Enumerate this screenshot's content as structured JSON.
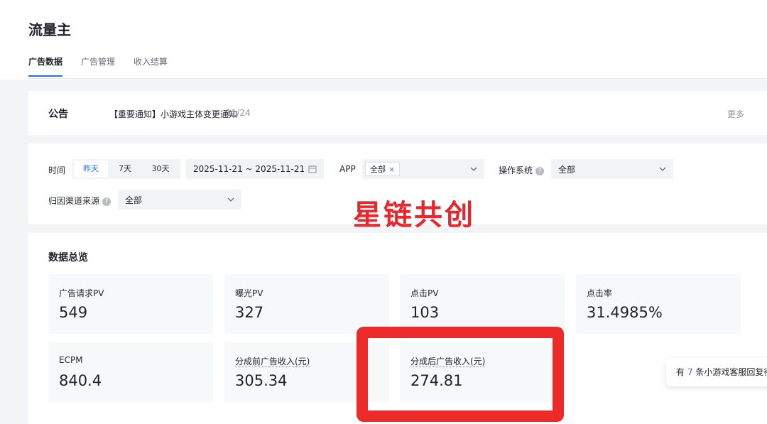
{
  "app": {
    "title": "流量主"
  },
  "tabs": [
    {
      "label": "广告数据",
      "active": true
    },
    {
      "label": "广告管理",
      "active": false
    },
    {
      "label": "收入结算",
      "active": false
    }
  ],
  "notice": {
    "label": "公告",
    "text": "【重要通知】小游戏主体变更通知",
    "date": "11/24",
    "more": "更多"
  },
  "filters": {
    "time_label": "时间",
    "time_options": [
      "昨天",
      "7天",
      "30天"
    ],
    "time_selected": "昨天",
    "date_range": "2025-11-21 ~ 2025-11-21",
    "app_label": "APP",
    "app_tag": "全部",
    "os_label": "操作系统",
    "os_value": "全部",
    "channel_label": "归因渠道来源",
    "channel_value": "全部"
  },
  "watermark": "星链共创",
  "overview": {
    "title": "数据总览",
    "metrics": [
      {
        "label": "广告请求PV",
        "value": "549"
      },
      {
        "label": "曝光PV",
        "value": "327"
      },
      {
        "label": "点击PV",
        "value": "103"
      },
      {
        "label": "点击率",
        "value": "31.4985%"
      },
      {
        "label": "ECPM",
        "value": "840.4"
      },
      {
        "label": "分成前广告收入(元)",
        "value": "305.34"
      },
      {
        "label": "分成后广告收入(元)",
        "value": "274.81"
      }
    ]
  },
  "toast": {
    "prefix": "有",
    "count": "7",
    "suffix": "条小游戏客服回复待"
  },
  "colors": {
    "accent": "#2b6cf0",
    "highlight": "#ed2a2a",
    "watermark": "#e8262b"
  }
}
